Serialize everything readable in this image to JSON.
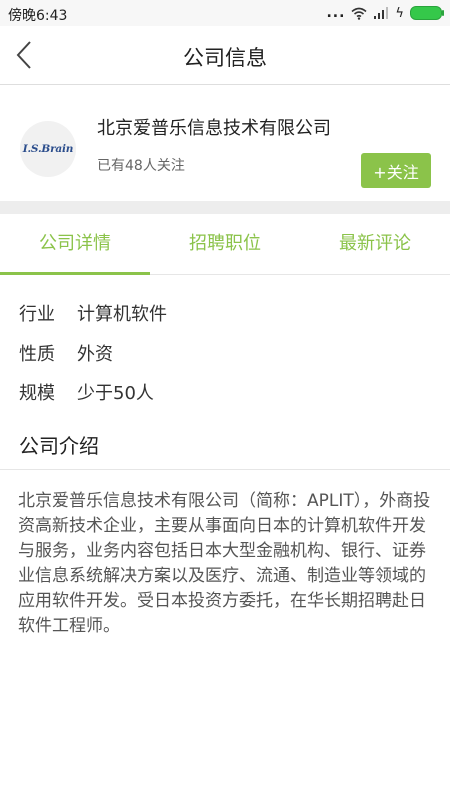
{
  "status_bar": {
    "time": "傍晚6:43",
    "dots": "...",
    "charge_symbol": "ϟ"
  },
  "nav": {
    "title": "公司信息",
    "back_icon": "chevron-left-icon"
  },
  "company": {
    "logo_text": "I.S.Brain",
    "name": "北京爱普乐信息技术有限公司",
    "followers": "已有48人关注",
    "follow_button": "+关注"
  },
  "tabs": [
    {
      "label": "公司详情",
      "active": true
    },
    {
      "label": "招聘职位",
      "active": false
    },
    {
      "label": "最新评论",
      "active": false
    }
  ],
  "details": {
    "industry_label": "行业",
    "industry_value": "计算机软件",
    "nature_label": "性质",
    "nature_value": "外资",
    "scale_label": "规模",
    "scale_value": "少于50人"
  },
  "intro": {
    "title": "公司介绍",
    "text": "北京爱普乐信息技术有限公司（简称：APLIT），外商投资高新技术企业，主要从事面向日本的计算机软件开发与服务，业务内容包括日本大型金融机构、银行、证券业信息系统解决方案以及医疗、流通、制造业等领域的应用软件开发。受日本投资方委托，在华长期招聘赴日软件工程师。"
  },
  "colors": {
    "accent": "#8bc34a",
    "battery": "#35c84a"
  }
}
